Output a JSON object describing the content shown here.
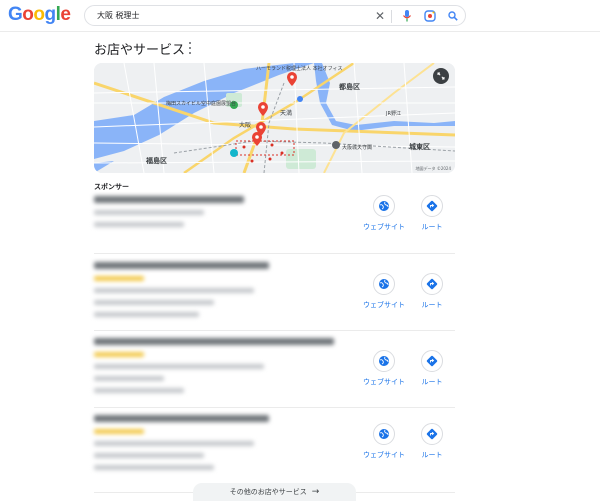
{
  "search": {
    "query": "大阪 税理士"
  },
  "section": {
    "title": "お店やサービス"
  },
  "map": {
    "labels": {
      "osaka_station_area": "大阪",
      "tenma": "天満",
      "miyakojima": "都島区",
      "fukushima": "福島区",
      "joto": "城東区",
      "osaka_castle": "大阪城天守閣",
      "office": "ハーモランド税理士法人 本社オフィス",
      "umeda_sky": "梅田スカイビル空中庭園展望台",
      "jr_noe": "JR野江",
      "attribution": "地図データ ©2024"
    }
  },
  "sponsor_label": "スポンサー",
  "results": [
    {
      "website_label": "ウェブサイト",
      "route_label": "ルート"
    },
    {
      "website_label": "ウェブサイト",
      "route_label": "ルート"
    },
    {
      "website_label": "ウェブサイト",
      "route_label": "ルート"
    },
    {
      "website_label": "ウェブサイト",
      "route_label": "ルート"
    }
  ],
  "more_button": {
    "label": "その他のお店やサービス"
  },
  "colors": {
    "accent": "#1a73e8",
    "pin": "#ea4335",
    "water": "#4a89d9",
    "park": "#34a853"
  }
}
